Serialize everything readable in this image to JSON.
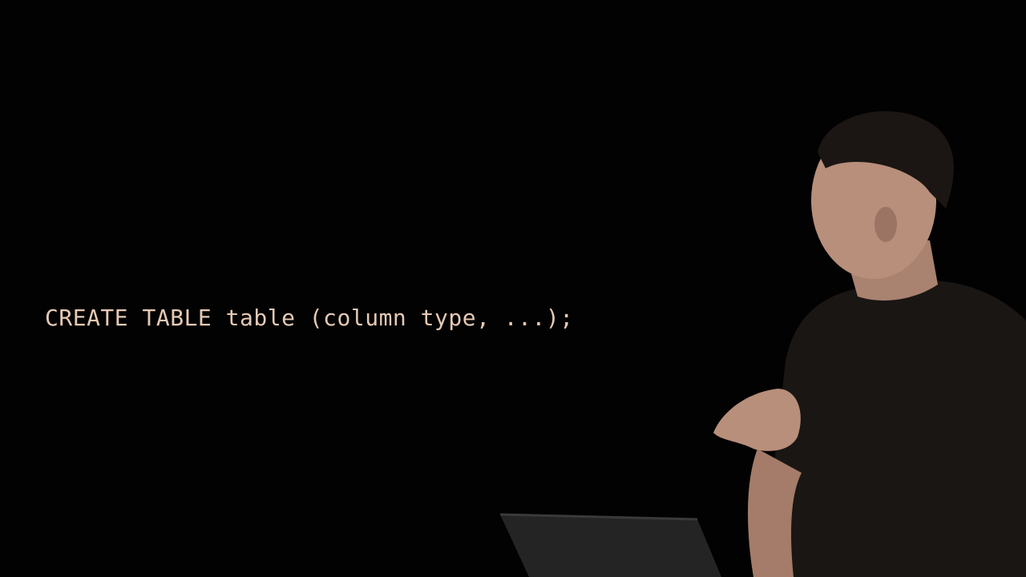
{
  "slide": {
    "code": "CREATE TABLE table (column type, ...);"
  },
  "colors": {
    "background": "#020202",
    "code_text": "#e6c9b4",
    "skin": "#b88f7a",
    "shirt": "#1a1614",
    "hair": "#1b1613",
    "laptop": "#242424"
  },
  "scene": {
    "presenter_image": "presenter-photo",
    "laptop_image": "laptop-icon"
  }
}
